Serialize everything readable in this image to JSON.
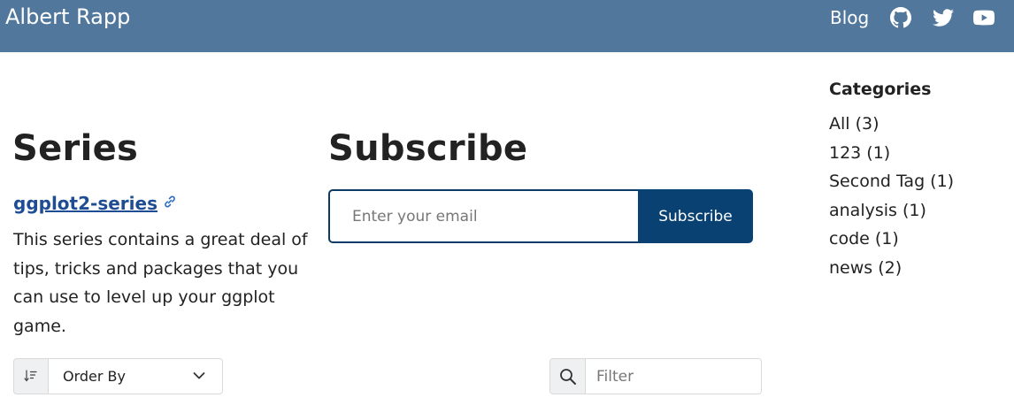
{
  "navbar": {
    "brand": "Albert Rapp",
    "blog_link": "Blog",
    "icons": [
      "github-icon",
      "twitter-icon",
      "youtube-icon"
    ],
    "background_color": "#51779c"
  },
  "series": {
    "title": "Series",
    "link_text": "ggplot2-series",
    "description": "This series contains a great deal of tips, tricks and packages that you can use to level up your ggplot game."
  },
  "subscribe": {
    "title": "Subscribe",
    "email_placeholder": "Enter your email",
    "button_label": "Subscribe",
    "button_color": "#084172"
  },
  "categories": {
    "heading": "Categories",
    "items": [
      {
        "label": "All (3)"
      },
      {
        "label": "123 (1)"
      },
      {
        "label": "Second Tag (1)"
      },
      {
        "label": "analysis (1)"
      },
      {
        "label": "code (1)"
      },
      {
        "label": "news (2)"
      }
    ]
  },
  "controls": {
    "order_by_label": "Order By",
    "filter_placeholder": "Filter"
  }
}
